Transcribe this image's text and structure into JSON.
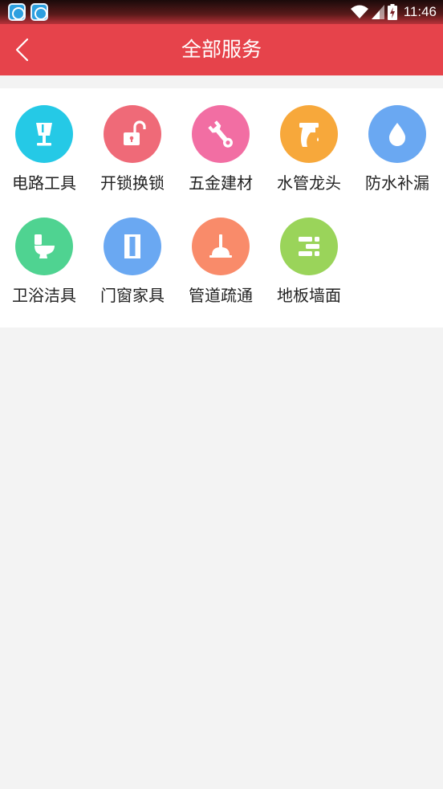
{
  "status_bar": {
    "time": "11:46"
  },
  "header": {
    "title": "全部服务"
  },
  "colors": {
    "header_bg": "#e6434b",
    "lamp": "#25c9e6",
    "lock": "#ef6a78",
    "wrench": "#f26ea3",
    "faucet": "#f7a83b",
    "drop": "#6aa8f2",
    "toilet": "#4fd391",
    "door": "#6aa8f2",
    "plunger": "#f98b6a",
    "floor": "#9ad45a"
  },
  "services": [
    {
      "label": "电路工具",
      "icon": "lamp-icon"
    },
    {
      "label": "开锁换锁",
      "icon": "unlock-icon"
    },
    {
      "label": "五金建材",
      "icon": "wrench-icon"
    },
    {
      "label": "水管龙头",
      "icon": "faucet-icon"
    },
    {
      "label": "防水补漏",
      "icon": "water-drop-icon"
    },
    {
      "label": "卫浴洁具",
      "icon": "toilet-icon"
    },
    {
      "label": "门窗家具",
      "icon": "door-icon"
    },
    {
      "label": "管道疏通",
      "icon": "plunger-icon"
    },
    {
      "label": "地板墙面",
      "icon": "floor-tiles-icon"
    }
  ]
}
